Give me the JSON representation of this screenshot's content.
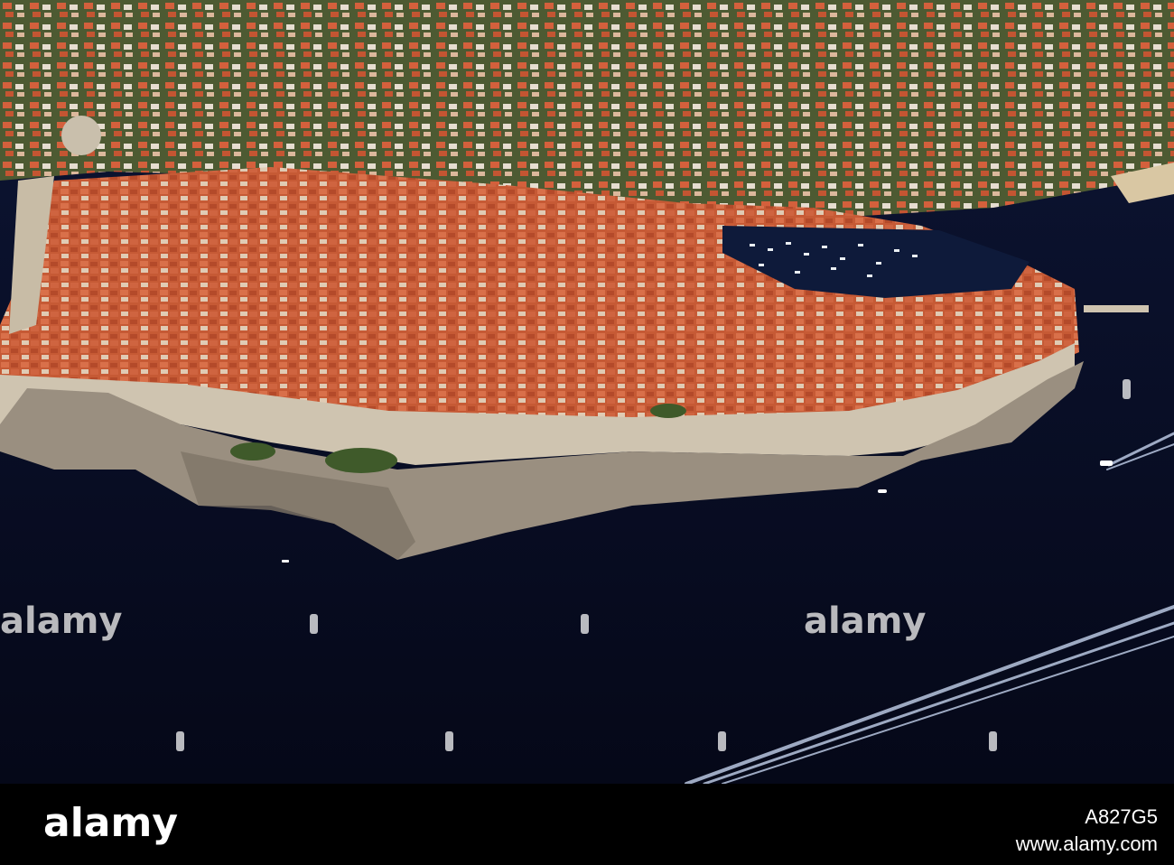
{
  "photo": {
    "subject": "aerial-walled-old-town-on-cliffs-by-sea",
    "colors": {
      "sea": "#0a0f2a",
      "roofs": "#c9542f",
      "walls": "#cfc4b0",
      "cliffs": "#9a8f80",
      "vegetation": "#3f5a2a"
    }
  },
  "watermark": {
    "text": "alamy"
  },
  "footer": {
    "brand": "alamy",
    "image_id": "A827G5",
    "url": "www.alamy.com"
  }
}
